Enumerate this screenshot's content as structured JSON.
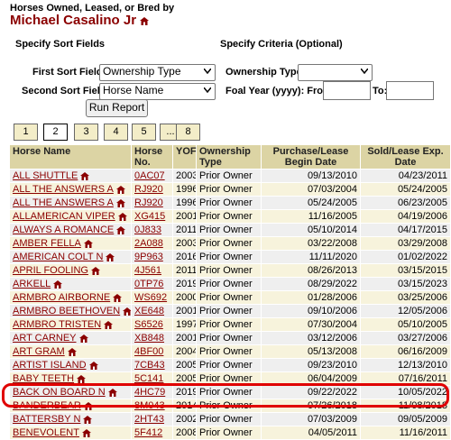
{
  "header": {
    "subtitle": "Horses Owned, Leased, or Bred by",
    "owner_name": "Michael Casalino Jr"
  },
  "sort": {
    "section_title": "Specify Sort Fields",
    "first_label": "First Sort Field:",
    "first_value": "Ownership Type",
    "second_label": "Second Sort Field:",
    "second_value": "Horse Name",
    "run_label": "Run Report"
  },
  "criteria": {
    "section_title": "Specify Criteria (Optional)",
    "ownership_label": "Ownership Type:",
    "ownership_value": "",
    "foal_label": "Foal Year (yyyy): From:",
    "to_label": "To:",
    "from_value": "",
    "to_value": ""
  },
  "pagination": {
    "pages": [
      "1",
      "2",
      "3",
      "4",
      "5",
      "...",
      "8"
    ],
    "current": "2"
  },
  "table": {
    "headers": {
      "name": "Horse Name",
      "no": "Horse No.",
      "yof": "YOF",
      "type": "Ownership Type",
      "begin": "Purchase/Lease Begin Date",
      "exp": "Sold/Lease Exp. Date"
    },
    "rows": [
      {
        "name": "ALL SHUTTLE",
        "no": "0AC07",
        "yof": "2003",
        "type": "Prior Owner",
        "begin": "09/13/2010",
        "exp": "04/23/2011"
      },
      {
        "name": "ALL THE ANSWERS A",
        "no": "RJ920",
        "yof": "1996",
        "type": "Prior Owner",
        "begin": "07/03/2004",
        "exp": "05/24/2005"
      },
      {
        "name": "ALL THE ANSWERS A",
        "no": "RJ920",
        "yof": "1996",
        "type": "Prior Owner",
        "begin": "05/24/2005",
        "exp": "06/23/2005"
      },
      {
        "name": "ALLAMERICAN VIPER",
        "no": "XG415",
        "yof": "2001",
        "type": "Prior Owner",
        "begin": "11/16/2005",
        "exp": "04/19/2006"
      },
      {
        "name": "ALWAYS A ROMANCE",
        "no": "0J833",
        "yof": "2011",
        "type": "Prior Owner",
        "begin": "05/10/2014",
        "exp": "04/17/2015"
      },
      {
        "name": "AMBER FELLA",
        "no": "2A088",
        "yof": "2003",
        "type": "Prior Owner",
        "begin": "03/22/2008",
        "exp": "03/29/2008"
      },
      {
        "name": "AMERICAN COLT N",
        "no": "9P963",
        "yof": "2016",
        "type": "Prior Owner",
        "begin": "11/11/2020",
        "exp": "01/02/2022"
      },
      {
        "name": "APRIL FOOLING",
        "no": "4J561",
        "yof": "2011",
        "type": "Prior Owner",
        "begin": "08/26/2013",
        "exp": "03/15/2015"
      },
      {
        "name": "ARKELL",
        "no": "0TP76",
        "yof": "2019",
        "type": "Prior Owner",
        "begin": "08/29/2022",
        "exp": "03/15/2023"
      },
      {
        "name": "ARMBRO AIRBORNE",
        "no": "WS692",
        "yof": "2000",
        "type": "Prior Owner",
        "begin": "01/28/2006",
        "exp": "03/25/2006"
      },
      {
        "name": "ARMBRO BEETHOVEN",
        "no": "XE648",
        "yof": "2001",
        "type": "Prior Owner",
        "begin": "09/10/2006",
        "exp": "12/05/2006"
      },
      {
        "name": "ARMBRO TRISTEN",
        "no": "S6526",
        "yof": "1997",
        "type": "Prior Owner",
        "begin": "07/30/2004",
        "exp": "05/10/2005"
      },
      {
        "name": "ART CARNEY",
        "no": "XB848",
        "yof": "2001",
        "type": "Prior Owner",
        "begin": "03/12/2006",
        "exp": "03/27/2006"
      },
      {
        "name": "ART GRAM",
        "no": "4BF00",
        "yof": "2004",
        "type": "Prior Owner",
        "begin": "05/13/2008",
        "exp": "06/16/2009"
      },
      {
        "name": "ARTIST ISLAND",
        "no": "7CB43",
        "yof": "2005",
        "type": "Prior Owner",
        "begin": "09/23/2010",
        "exp": "12/13/2010"
      },
      {
        "name": "BABY TEETH",
        "no": "5C141",
        "yof": "2005",
        "type": "Prior Owner",
        "begin": "06/04/2009",
        "exp": "07/16/2011"
      },
      {
        "name": "BACK ON BOARD N",
        "no": "4HC79",
        "yof": "2019",
        "type": "Prior Owner",
        "begin": "09/22/2022",
        "exp": "10/05/2022"
      },
      {
        "name": "BANDERBEAR",
        "no": "8M043",
        "yof": "2014",
        "type": "Prior Owner",
        "begin": "07/26/2018",
        "exp": "11/08/2018"
      },
      {
        "name": "BATTERSBY N",
        "no": "2HT43",
        "yof": "2002",
        "type": "Prior Owner",
        "begin": "07/03/2009",
        "exp": "09/05/2009"
      },
      {
        "name": "BENEVOLENT",
        "no": "5F412",
        "yof": "2008",
        "type": "Prior Owner",
        "begin": "04/05/2011",
        "exp": "11/16/2011"
      }
    ]
  },
  "colors": {
    "owner_name": "#8b0000",
    "header_bg": "#dcd4a4",
    "highlight": "#e00000"
  }
}
